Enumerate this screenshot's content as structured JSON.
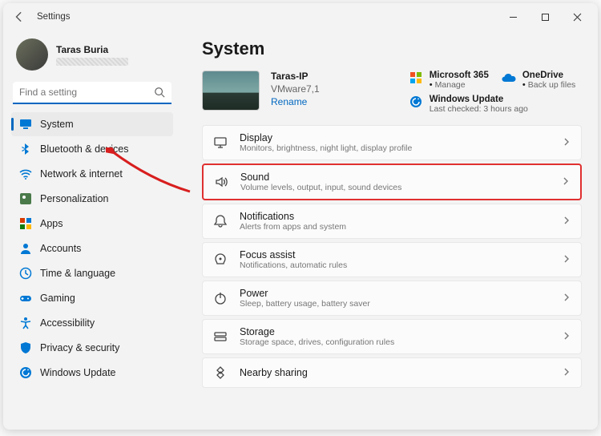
{
  "titlebar": {
    "title": "Settings"
  },
  "profile": {
    "name": "Taras Buria"
  },
  "search": {
    "placeholder": "Find a setting"
  },
  "sidebar": {
    "items": [
      {
        "label": "System",
        "icon": "system",
        "active": true
      },
      {
        "label": "Bluetooth & devices",
        "icon": "bluetooth"
      },
      {
        "label": "Network & internet",
        "icon": "network"
      },
      {
        "label": "Personalization",
        "icon": "personalization"
      },
      {
        "label": "Apps",
        "icon": "apps"
      },
      {
        "label": "Accounts",
        "icon": "accounts"
      },
      {
        "label": "Time & language",
        "icon": "time"
      },
      {
        "label": "Gaming",
        "icon": "gaming"
      },
      {
        "label": "Accessibility",
        "icon": "accessibility"
      },
      {
        "label": "Privacy & security",
        "icon": "privacy"
      },
      {
        "label": "Windows Update",
        "icon": "update"
      }
    ]
  },
  "main": {
    "heading": "System",
    "device": {
      "name": "Taras-IP",
      "model": "VMware7,1",
      "rename": "Rename"
    },
    "cards": {
      "ms365": {
        "title": "Microsoft 365",
        "sub": "Manage"
      },
      "onedrive": {
        "title": "OneDrive",
        "sub": "Back up files"
      },
      "update": {
        "title": "Windows Update",
        "sub": "Last checked: 3 hours ago"
      }
    },
    "rows": [
      {
        "icon": "display",
        "title": "Display",
        "sub": "Monitors, brightness, night light, display profile"
      },
      {
        "icon": "sound",
        "title": "Sound",
        "sub": "Volume levels, output, input, sound devices",
        "highlight": true
      },
      {
        "icon": "notifications",
        "title": "Notifications",
        "sub": "Alerts from apps and system"
      },
      {
        "icon": "focus",
        "title": "Focus assist",
        "sub": "Notifications, automatic rules"
      },
      {
        "icon": "power",
        "title": "Power",
        "sub": "Sleep, battery usage, battery saver"
      },
      {
        "icon": "storage",
        "title": "Storage",
        "sub": "Storage space, drives, configuration rules"
      },
      {
        "icon": "nearby",
        "title": "Nearby sharing",
        "sub": ""
      }
    ]
  }
}
